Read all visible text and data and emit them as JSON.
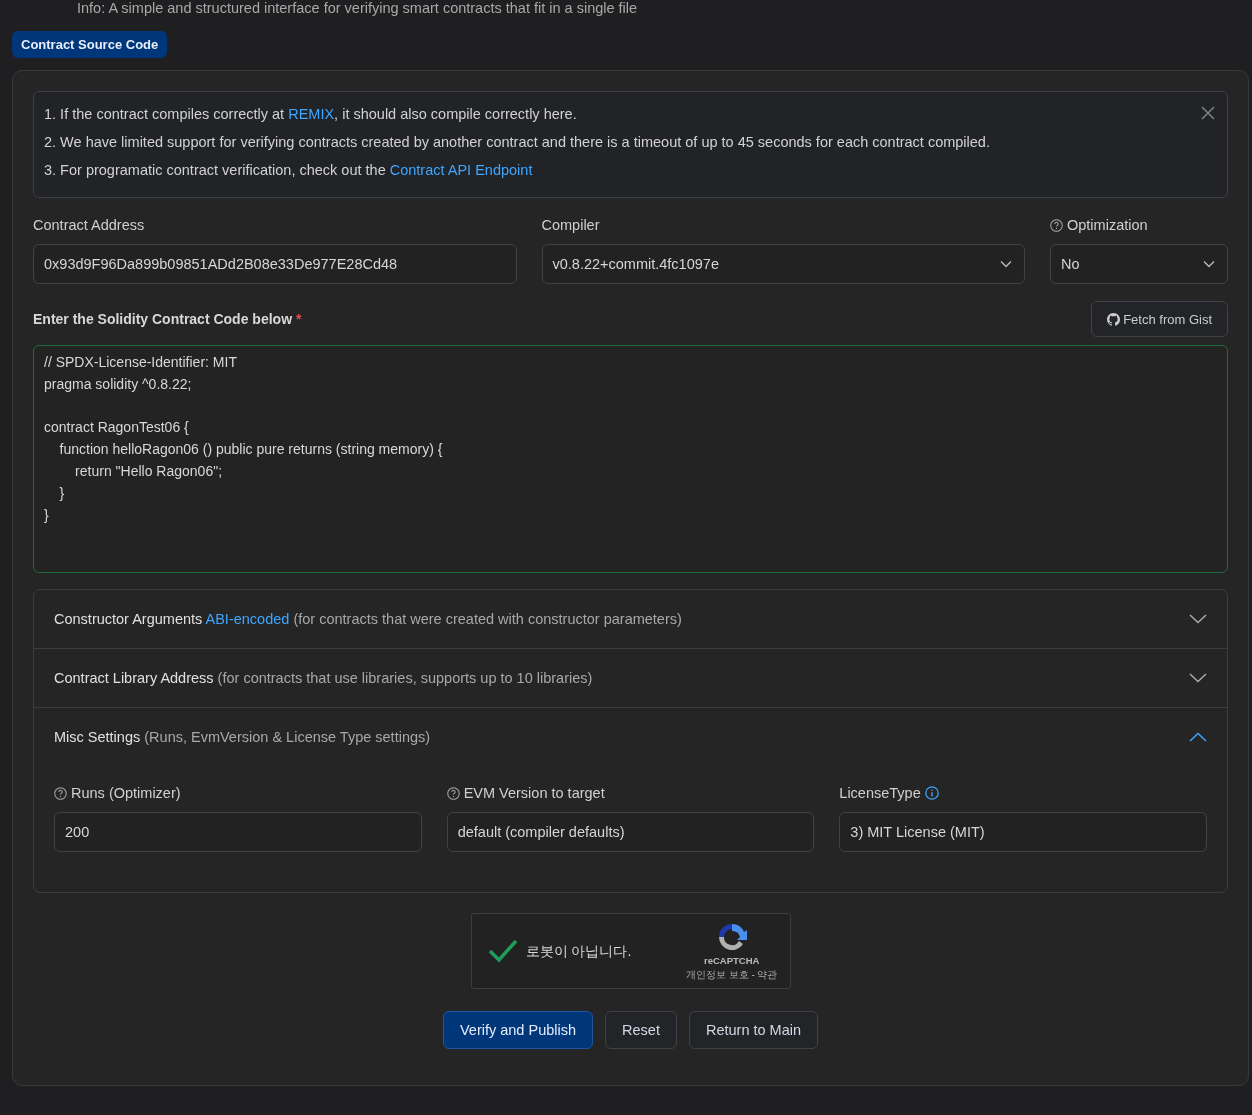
{
  "info": "Info: A simple and structured interface for verifying smart contracts that fit in a single file",
  "tabs": [
    {
      "label": "Contract Source Code",
      "selected": true
    }
  ],
  "notice": {
    "lines": [
      [
        {
          "kind": "text",
          "text": "1. If the contract compiles correctly at "
        },
        {
          "kind": "link",
          "text": "REMIX"
        },
        {
          "kind": "text",
          "text": ", it should also compile correctly here."
        }
      ],
      [
        {
          "kind": "text",
          "text": "2. We have limited support for verifying contracts created by another contract and there is a timeout of up to 45 seconds for each contract compiled."
        }
      ],
      [
        {
          "kind": "text",
          "text": "3. For programatic contract verification, check out the "
        },
        {
          "kind": "link",
          "text": "Contract API Endpoint"
        }
      ]
    ]
  },
  "fields": [
    {
      "label": "Contract Address",
      "value": "0x93d9F96Da899b09851ADd2B08e33De977E28Cd48",
      "kind": "input"
    },
    {
      "label": "Compiler",
      "value": "v0.8.22+commit.4fc1097e",
      "kind": "select"
    },
    {
      "label": "Optimization",
      "value": "No",
      "kind": "help-select"
    }
  ],
  "code_editor": {
    "label": "Enter the Solidity Contract Code below",
    "required_mark": "*",
    "fetch_button": "Fetch from Gist",
    "value": "// SPDX-License-Identifier: MIT\npragma solidity ^0.8.22;\n\ncontract RagonTest06 {\n    function helloRagon06 () public pure returns (string memory) {\n        return \"Hello Ragon06\";\n    }\n}"
  },
  "sections": [
    {
      "title": "Constructor Arguments",
      "link": "ABI-encoded",
      "note": "(for contracts that were created with constructor parameters)",
      "expanded": false
    },
    {
      "title": "Contract Library Address",
      "note": "(for contracts that use libraries, supports up to 10 libraries)",
      "expanded": false
    },
    {
      "title": "Misc Settings",
      "note": "(Runs, EvmVersion & License Type settings)",
      "expanded": true,
      "fields": [
        {
          "label": "Runs (Optimizer)",
          "value": "200",
          "kind": "help-input"
        },
        {
          "label": "EVM Version to target",
          "value": "default (compiler defaults)",
          "kind": "help-input"
        },
        {
          "label": "LicenseType",
          "value": "3) MIT License (MIT)",
          "kind": "info-input"
        }
      ]
    }
  ],
  "captcha": {
    "checked": true,
    "label": "로봇이 아닙니다.",
    "brand": "reCAPTCHA",
    "terms": "개인정보 보호 - 약관"
  },
  "buttons": [
    {
      "label": "Verify and Publish",
      "kind": "primary"
    },
    {
      "label": "Reset",
      "kind": "secondary"
    },
    {
      "label": "Return to Main",
      "kind": "secondary"
    }
  ]
}
